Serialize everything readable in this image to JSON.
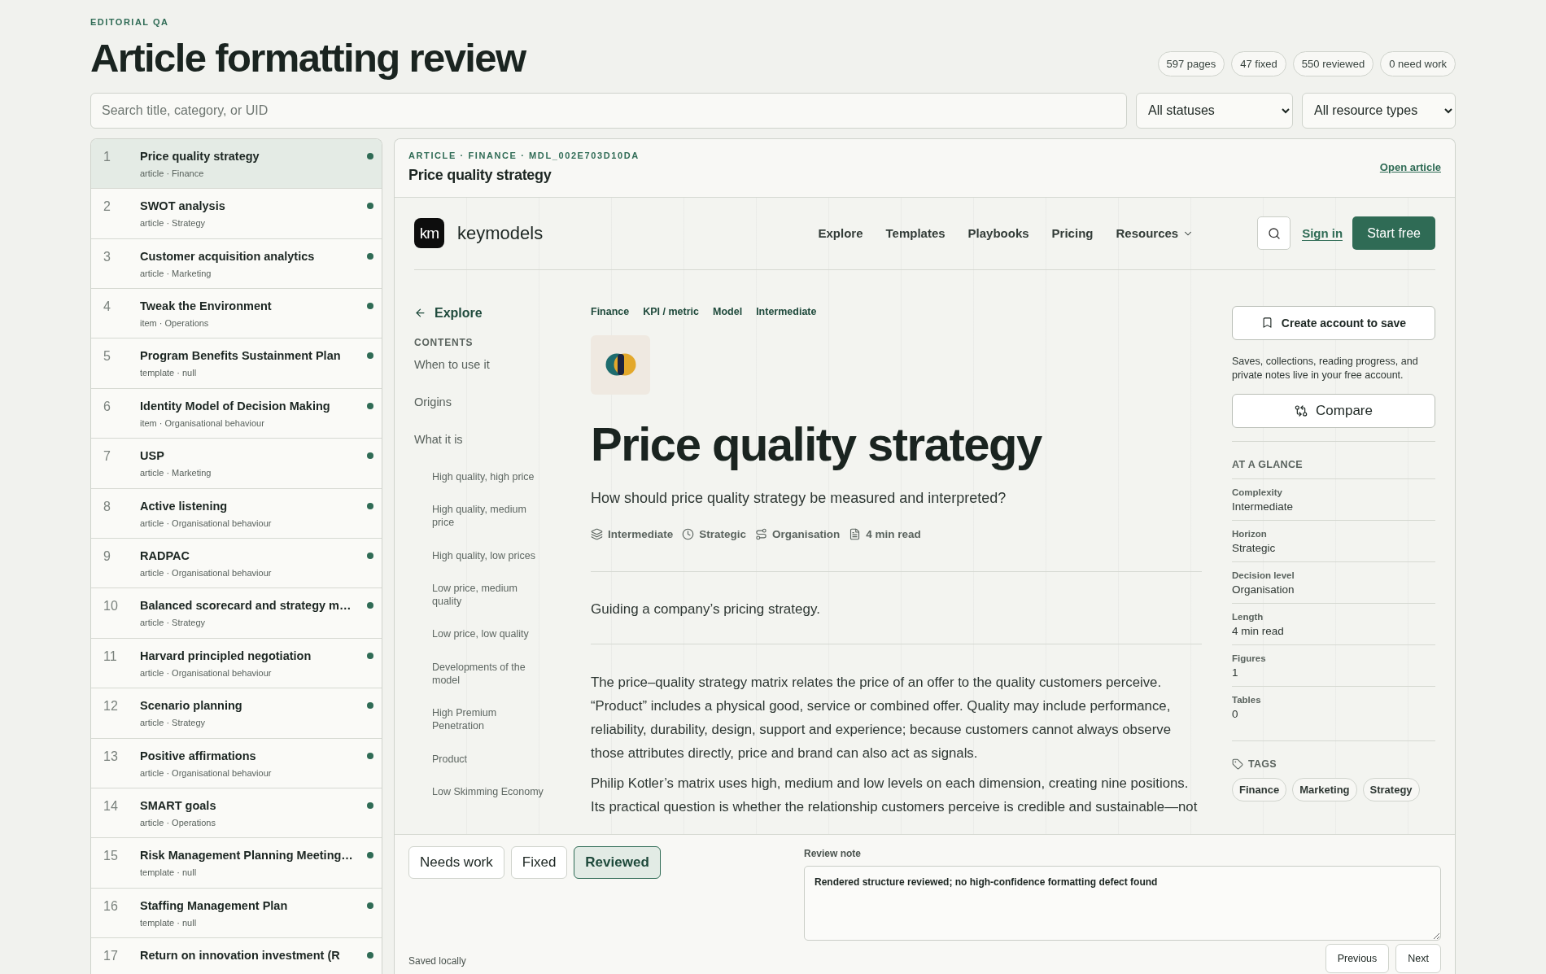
{
  "header": {
    "eyebrow": "EDITORIAL QA",
    "title": "Article formatting review",
    "stats": [
      "597 pages",
      "47 fixed",
      "550 reviewed",
      "0 need work"
    ]
  },
  "filters": {
    "search": {
      "placeholder": "Search title, category, or UID"
    },
    "status_select": "All statuses",
    "type_select": "All resource types"
  },
  "pages": [
    {
      "number": "1",
      "title": "Price quality strategy",
      "meta": "article · Finance",
      "selected": true
    },
    {
      "number": "2",
      "title": "SWOT analysis",
      "meta": "article · Strategy",
      "selected": false
    },
    {
      "number": "3",
      "title": "Customer acquisition analytics",
      "meta": "article · Marketing",
      "selected": false
    },
    {
      "number": "4",
      "title": "Tweak the Environment",
      "meta": "item · Operations",
      "selected": false
    },
    {
      "number": "5",
      "title": "Program Benefits Sustainment Plan",
      "meta": "template · null",
      "selected": false
    },
    {
      "number": "6",
      "title": "Identity Model of Decision Making",
      "meta": "item · Organisational behaviour",
      "selected": false
    },
    {
      "number": "7",
      "title": "USP",
      "meta": "article · Marketing",
      "selected": false
    },
    {
      "number": "8",
      "title": "Active listening",
      "meta": "article · Organisational behaviour",
      "selected": false
    },
    {
      "number": "9",
      "title": "RADPAC",
      "meta": "article · Organisational behaviour",
      "selected": false
    },
    {
      "number": "10",
      "title": "Balanced scorecard and strategy m…",
      "meta": "article · Strategy",
      "selected": false
    },
    {
      "number": "11",
      "title": "Harvard principled negotiation",
      "meta": "article · Organisational behaviour",
      "selected": false
    },
    {
      "number": "12",
      "title": "Scenario planning",
      "meta": "article · Strategy",
      "selected": false
    },
    {
      "number": "13",
      "title": "Positive affirmations",
      "meta": "article · Organisational behaviour",
      "selected": false
    },
    {
      "number": "14",
      "title": "SMART goals",
      "meta": "article · Operations",
      "selected": false
    },
    {
      "number": "15",
      "title": "Risk Management Planning Meeting…",
      "meta": "template · null",
      "selected": false
    },
    {
      "number": "16",
      "title": "Staffing Management Plan",
      "meta": "template · null",
      "selected": false
    },
    {
      "number": "17",
      "title": "Return on innovation investment (R",
      "selected": false
    }
  ],
  "preview": {
    "eyebrow": "ARTICLE · FINANCE · MDL_002E703D10DA",
    "title": "Price quality strategy",
    "open_link": "Open article",
    "site": {
      "logo_mark": "km",
      "brand": "keymodels",
      "nav": [
        {
          "label": "Explore",
          "dropdown": false
        },
        {
          "label": "Templates",
          "dropdown": false
        },
        {
          "label": "Playbooks",
          "dropdown": false
        },
        {
          "label": "Pricing",
          "dropdown": false
        },
        {
          "label": "Resources",
          "dropdown": true
        }
      ],
      "sign_in": "Sign in",
      "cta": "Start free",
      "back_link": "Explore",
      "contents_heading": "CONTENTS",
      "contents": [
        {
          "label": "When to use it"
        },
        {
          "label": "Origins"
        },
        {
          "label": "What it is",
          "children": [
            {
              "label": "High quality, high price"
            },
            {
              "label": "High quality, medium price"
            },
            {
              "label": "High quality, low prices"
            },
            {
              "label": "Low price, medium quality"
            },
            {
              "label": "Low price, low quality"
            },
            {
              "label": "Developments of the model"
            },
            {
              "label": "High Premium Penetration"
            },
            {
              "label": "Product"
            },
            {
              "label": "Low Skimming Economy"
            }
          ]
        }
      ],
      "breadcrumbs": [
        "Finance",
        "KPI / metric",
        "Model",
        "Intermediate"
      ],
      "title": "Price quality strategy",
      "subtitle": "How should price quality strategy be measured and interpreted?",
      "facts": [
        {
          "kind": "complexity",
          "text": "Intermediate"
        },
        {
          "kind": "horizon",
          "text": "Strategic"
        },
        {
          "kind": "decision",
          "text": "Organisation"
        },
        {
          "kind": "length",
          "text": "4 min read"
        }
      ],
      "summary": "Guiding a company’s pricing strategy.",
      "paragraphs": [
        "The price–quality strategy matrix relates the price of an offer to the quality customers perceive. “Product” includes a physical good, service or combined offer. Quality may include performance, reliability, durability, design, support and experience; because customers cannot always observe those attributes directly, price and brand can also act as signals.",
        "Philip Kotler’s matrix uses high, medium and low levels on each dimension, creating nine positions. Its practical question is whether the relationship customers perceive is credible and sustainable—not"
      ],
      "sidebar": {
        "save_button": "Create account to save",
        "save_note": "Saves, collections, reading progress, and private notes live in your free account.",
        "compare_button": "Compare",
        "glance_heading": "AT A GLANCE",
        "glance": [
          {
            "label": "Complexity",
            "value": "Intermediate"
          },
          {
            "label": "Horizon",
            "value": "Strategic"
          },
          {
            "label": "Decision level",
            "value": "Organisation"
          },
          {
            "label": "Length",
            "value": "4 min read"
          },
          {
            "label": "Figures",
            "value": "1"
          },
          {
            "label": "Tables",
            "value": "0"
          }
        ],
        "tags_heading": "TAGS",
        "tags": [
          "Finance",
          "Marketing",
          "Strategy"
        ]
      }
    }
  },
  "review": {
    "statuses": [
      {
        "label": "Needs work",
        "selected": false
      },
      {
        "label": "Fixed",
        "selected": false
      },
      {
        "label": "Reviewed",
        "selected": true
      }
    ],
    "note_label": "Review note",
    "note": "Rendered structure reviewed; no high-confidence formatting defect found",
    "saved": "Saved locally",
    "buttons": [
      "Previous",
      "Next"
    ]
  }
}
